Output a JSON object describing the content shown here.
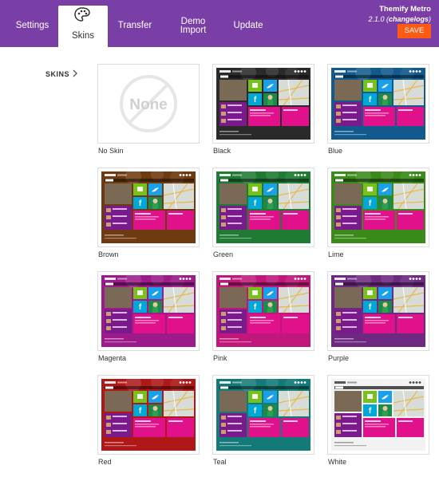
{
  "tabs": [
    {
      "label": "Settings",
      "active": false
    },
    {
      "label": "Skins",
      "active": true
    },
    {
      "label": "Transfer",
      "active": false
    },
    {
      "label_line1": "Demo",
      "label_line2": "Import",
      "active": false
    },
    {
      "label": "Update",
      "active": false
    }
  ],
  "theme": {
    "name": "Themify Metro",
    "version_prefix": "2.1.0 (",
    "changelogs": "changelogs",
    "version_suffix": ")",
    "save_label": "SAVE"
  },
  "sidebar": {
    "label": "SKINS"
  },
  "none_text": "None",
  "skins": [
    {
      "name": "No Skin",
      "bg": "#ffffff"
    },
    {
      "name": "Black",
      "bg": "#2a2a2a"
    },
    {
      "name": "Blue",
      "bg": "#125a8e"
    },
    {
      "name": "Brown",
      "bg": "#6e3a10"
    },
    {
      "name": "Green",
      "bg": "#1f7a34"
    },
    {
      "name": "Lime",
      "bg": "#3a8a1a"
    },
    {
      "name": "Magenta",
      "bg": "#9c1a8a"
    },
    {
      "name": "Pink",
      "bg": "#c0187a"
    },
    {
      "name": "Purple",
      "bg": "#6e2a82"
    },
    {
      "name": "Red",
      "bg": "#b01818"
    },
    {
      "name": "Teal",
      "bg": "#137a78"
    },
    {
      "name": "White",
      "bg": "#f2f2f2"
    }
  ],
  "colors": {
    "header": "#7a3fa6",
    "save": "#ff5a14"
  }
}
